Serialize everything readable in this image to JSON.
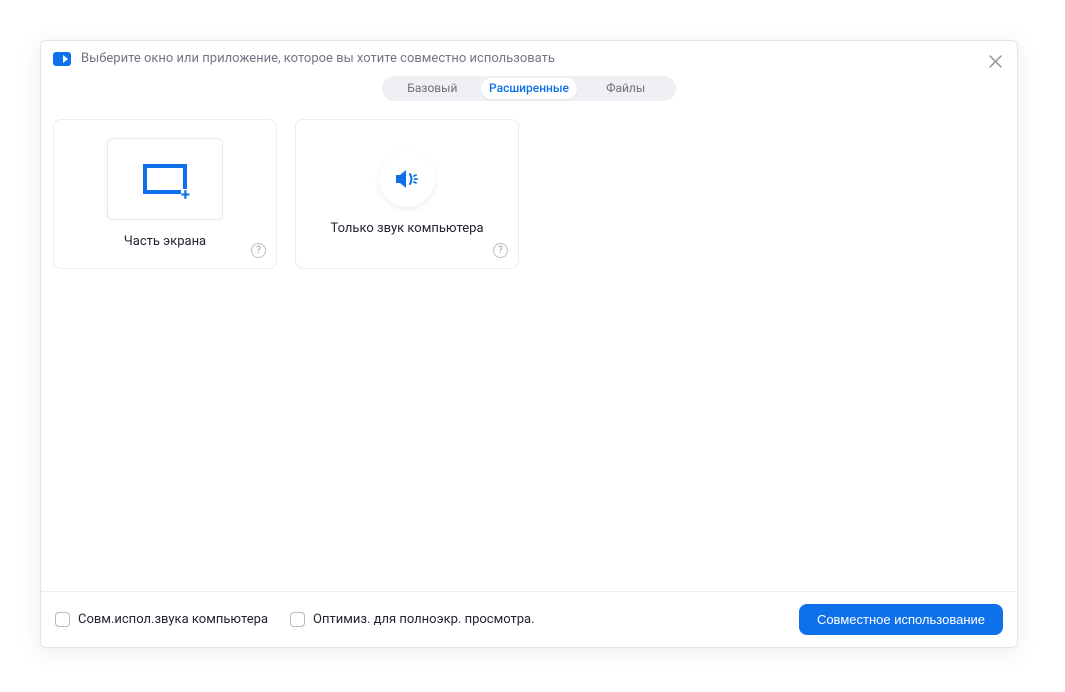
{
  "dialog": {
    "title": "Выберите окно или приложение, которое вы хотите совместно использовать"
  },
  "tabs": {
    "basic": "Базовый",
    "advanced": "Расширенные",
    "files": "Файлы"
  },
  "cards": {
    "portion": {
      "label": "Часть экрана"
    },
    "audio": {
      "label": "Только звук компьютера"
    }
  },
  "footer": {
    "shareAudio": "Совм.испол.звука компьютера",
    "optimize": "Оптимиз. для полноэкр. просмотра.",
    "shareButton": "Совместное использование"
  }
}
